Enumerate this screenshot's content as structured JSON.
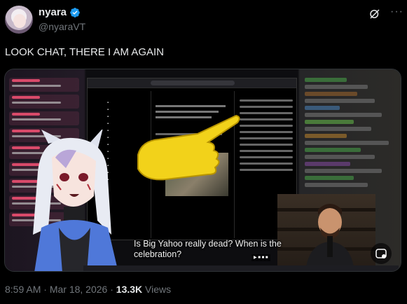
{
  "author": {
    "display_name": "nyara",
    "handle": "@nyaraVT",
    "verified": true
  },
  "icons": {
    "verified": "verified-badge-icon",
    "grok": "grok-icon",
    "more": "more-icon",
    "gif": "gif-icon"
  },
  "colors": {
    "verified": "#1d9bf0",
    "text": "#e7e9ea",
    "muted": "#71767b"
  },
  "tweet": {
    "text": "LOOK CHAT, THERE I AM AGAIN",
    "caption": "Is Big Yahoo really dead? When is the celebration?"
  },
  "meta": {
    "time": "8:59 AM",
    "separator": "·",
    "date": "Mar 18, 2026",
    "views_count": "13.3K",
    "views_label": "Views"
  }
}
